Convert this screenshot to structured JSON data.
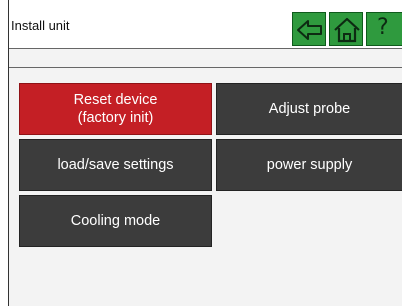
{
  "header": {
    "title": "Install unit",
    "buttons": {
      "back_icon": "arrow-left-icon",
      "home_icon": "home-icon",
      "help_label": "?"
    }
  },
  "menu": {
    "reset_line1": "Reset device",
    "reset_line2": "(factory init)",
    "adjust_probe": "Adjust probe",
    "load_save": "load/save settings",
    "power_supply": "power supply",
    "cooling_mode": "Cooling mode"
  },
  "colors": {
    "accent_green": "#2f9a3e",
    "selected_red": "#c41f25",
    "tile_dark": "#3c3c3c"
  }
}
